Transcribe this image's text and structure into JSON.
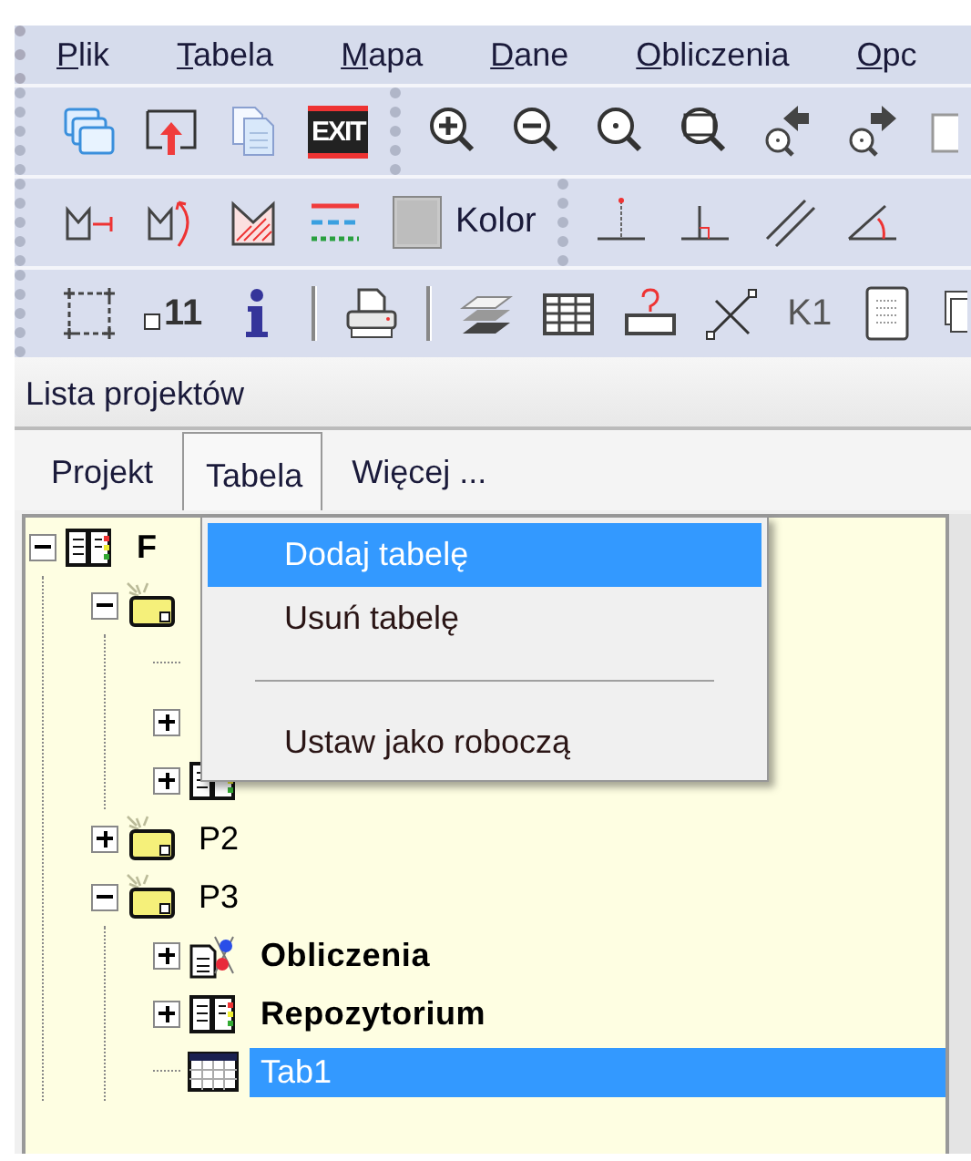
{
  "menu_bar": [
    {
      "label": "Plik"
    },
    {
      "label": "Tabela"
    },
    {
      "label": "Mapa"
    },
    {
      "label": "Dane"
    },
    {
      "label": "Obliczenia"
    },
    {
      "label": "Opc"
    }
  ],
  "toolbar": {
    "exit_label": "EXIT",
    "color_label": "Kolor",
    "point_number_label": "11",
    "k1_label": "K1"
  },
  "panel": {
    "title": "Lista projektów",
    "tabs": [
      {
        "label": "Projekt",
        "selected": false
      },
      {
        "label": "Tabela",
        "selected": true
      },
      {
        "label": "Więcej ...",
        "selected": false
      }
    ],
    "tree": {
      "kind": "repository",
      "label": "F",
      "bold": true,
      "expanded": true,
      "selected": false,
      "children": [
        {
          "kind": "project",
          "expanded": true,
          "children": [
            {
              "kind": "covered"
            },
            {
              "kind": "covered",
              "expanded": false
            },
            {
              "kind": "repository",
              "expanded": false
            }
          ]
        },
        {
          "kind": "project",
          "label": "P2",
          "bold": false,
          "expanded": false,
          "selected": false
        },
        {
          "kind": "project",
          "label": "P3",
          "bold": false,
          "expanded": true,
          "selected": false,
          "children": [
            {
              "kind": "calculations",
              "label": "Obliczenia",
              "bold": true,
              "expanded": false,
              "selected": false
            },
            {
              "kind": "repository",
              "label": "Repozytorium",
              "bold": true,
              "expanded": false,
              "selected": false
            },
            {
              "kind": "table",
              "label": "Tab1",
              "bold": false,
              "selected": true
            }
          ]
        }
      ]
    },
    "context_menu": [
      {
        "kind": "item",
        "label": "Dodaj tabelę",
        "selected": true
      },
      {
        "kind": "item",
        "label": "Usuń tabelę",
        "selected": false
      },
      {
        "kind": "separator"
      },
      {
        "kind": "item",
        "label": "Ustaw jako roboczą",
        "selected": false
      }
    ]
  }
}
